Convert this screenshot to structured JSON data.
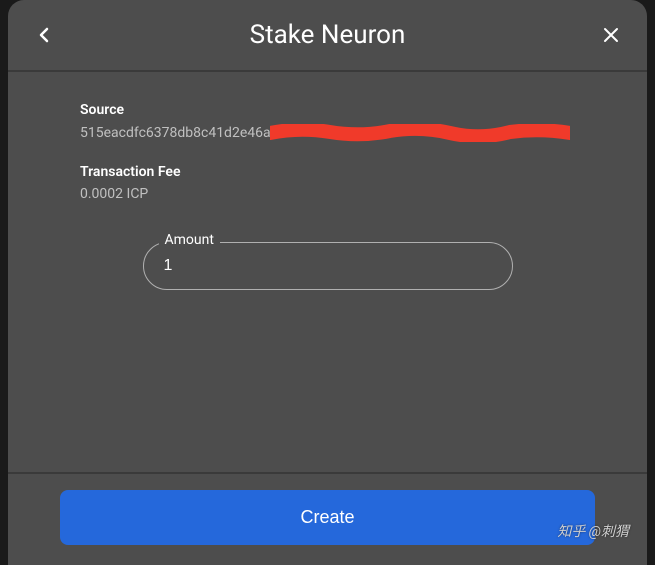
{
  "header": {
    "title": "Stake Neuron"
  },
  "source": {
    "label": "Source",
    "value": "515eacdfc6378db8c41d2e46a8"
  },
  "fee": {
    "label": "Transaction Fee",
    "value": "0.0002 ICP"
  },
  "amount": {
    "label": "Amount",
    "value": "1"
  },
  "footer": {
    "create_label": "Create"
  },
  "watermark": "知乎 @刺猬"
}
